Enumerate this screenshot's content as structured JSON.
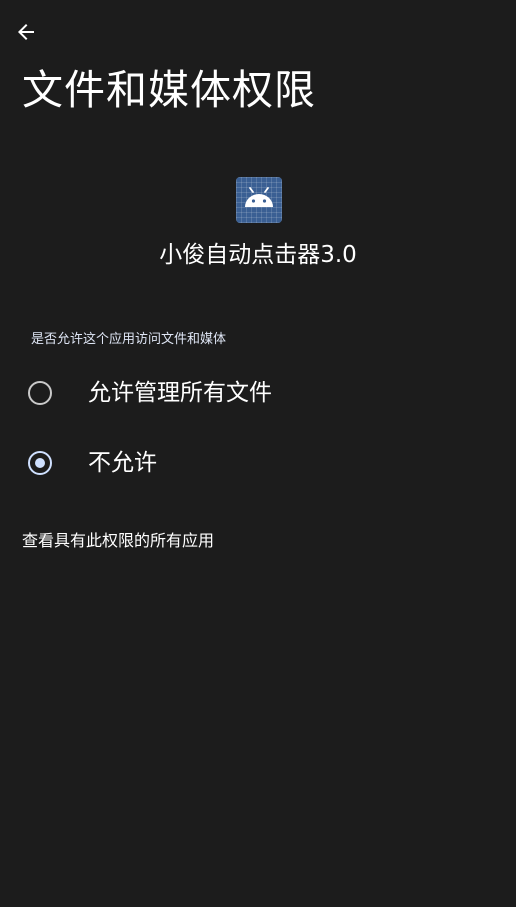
{
  "header": {
    "back_icon": "arrow-back-icon",
    "title": "文件和媒体权限"
  },
  "app": {
    "icon": "android-icon",
    "icon_color": "#3a5f93",
    "name": "小俊自动点击器3.0"
  },
  "permission": {
    "section_label": "是否允许这个应用访问文件和媒体",
    "options": [
      {
        "label": "允许管理所有文件",
        "selected": false
      },
      {
        "label": "不允许",
        "selected": true
      }
    ]
  },
  "footer": {
    "view_all_link": "查看具有此权限的所有应用"
  },
  "colors": {
    "background": "#1c1c1c",
    "text": "#ffffff",
    "accent": "#cfe0ff"
  }
}
